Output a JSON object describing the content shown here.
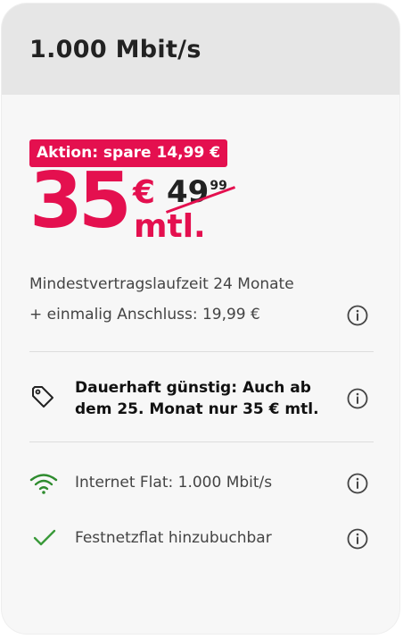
{
  "card": {
    "title": "1.000 Mbit/s",
    "promo_badge": "Aktion: spare 14,99 €",
    "price": {
      "amount": "35",
      "currency": "€",
      "period": "mtl.",
      "old_amount": "49",
      "old_cents": "99"
    },
    "contract": {
      "min_term": "Mindestvertragslaufzeit 24 Monate",
      "setup_fee": "+ einmalig Anschluss: 19,99 €"
    },
    "features": [
      {
        "icon": "price-tag-icon",
        "text": "Dauerhaft günstig: Auch ab dem 25. Monat nur 35 € mtl."
      },
      {
        "icon": "wifi-icon",
        "text": "Internet Flat: 1.000 Mbit/s"
      },
      {
        "icon": "checkmark-icon",
        "text": "Festnetzflat hinzubuchbar"
      }
    ]
  },
  "colors": {
    "accent": "#e4104f",
    "wifi": "#2e8b2e",
    "check": "#3a9a3a",
    "header_bg": "#e6e6e6",
    "card_bg": "#f7f7f7"
  }
}
